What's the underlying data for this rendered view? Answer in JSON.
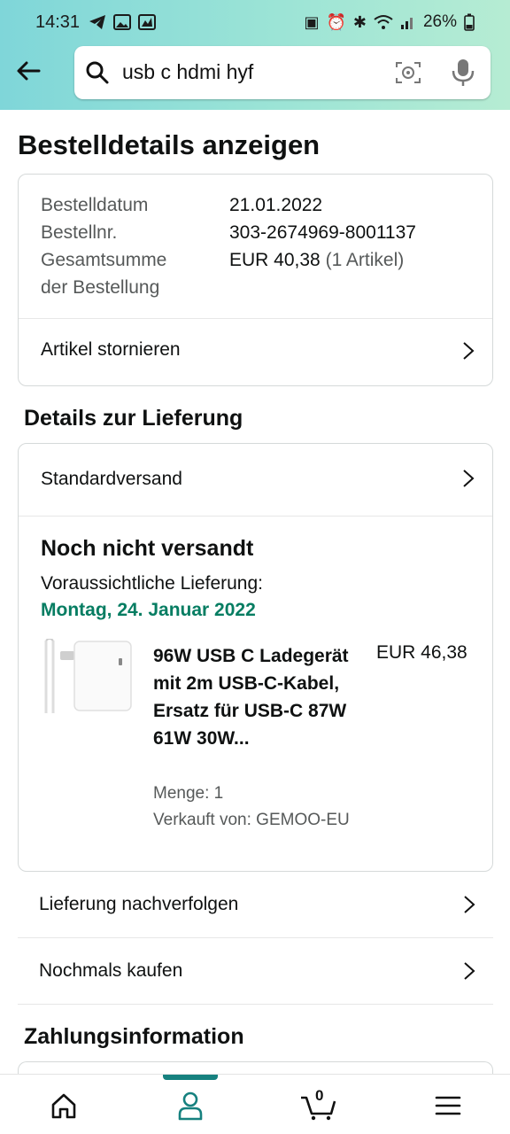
{
  "status_bar": {
    "time": "14:31",
    "battery": "26%"
  },
  "search": {
    "query": "usb c hdmi hyf"
  },
  "page": {
    "title": "Bestelldetails anzeigen"
  },
  "order_summary": {
    "date_label": "Bestelldatum",
    "date_value": "21.01.2022",
    "number_label": "Bestellnr.",
    "number_value": "303-2674969-8001137",
    "total_label_line1": "Gesamtsumme",
    "total_label_line2": "der Bestellung",
    "total_value": "EUR 40,38",
    "total_items": "(1 Artikel)",
    "cancel_label": "Artikel stornieren"
  },
  "delivery": {
    "section_title": "Details zur Lieferung",
    "shipping_method": "Standardversand",
    "status": "Noch nicht versandt",
    "eta_label": "Voraussichtliche Lieferung:",
    "eta_date": "Montag, 24. Januar 2022",
    "product": {
      "name": "96W USB C Ladegerät mit 2m USB-C-Kabel, Ersatz für USB-C 87W 61W 30W...",
      "price": "EUR 46,38",
      "quantity": "Menge: 1",
      "seller": "Verkauft von: GEMOO-EU"
    }
  },
  "actions": {
    "track": "Lieferung nachverfolgen",
    "buy_again": "Nochmals kaufen"
  },
  "payment": {
    "section_title": "Zahlungsinformation"
  },
  "bottom_nav": {
    "cart_count": "0",
    "active": "account"
  },
  "colors": {
    "accent_teal": "#16817f",
    "delivery_green": "#067d62",
    "header_gradient_start": "#7fd6d9",
    "header_gradient_end": "#b6ecd3"
  }
}
